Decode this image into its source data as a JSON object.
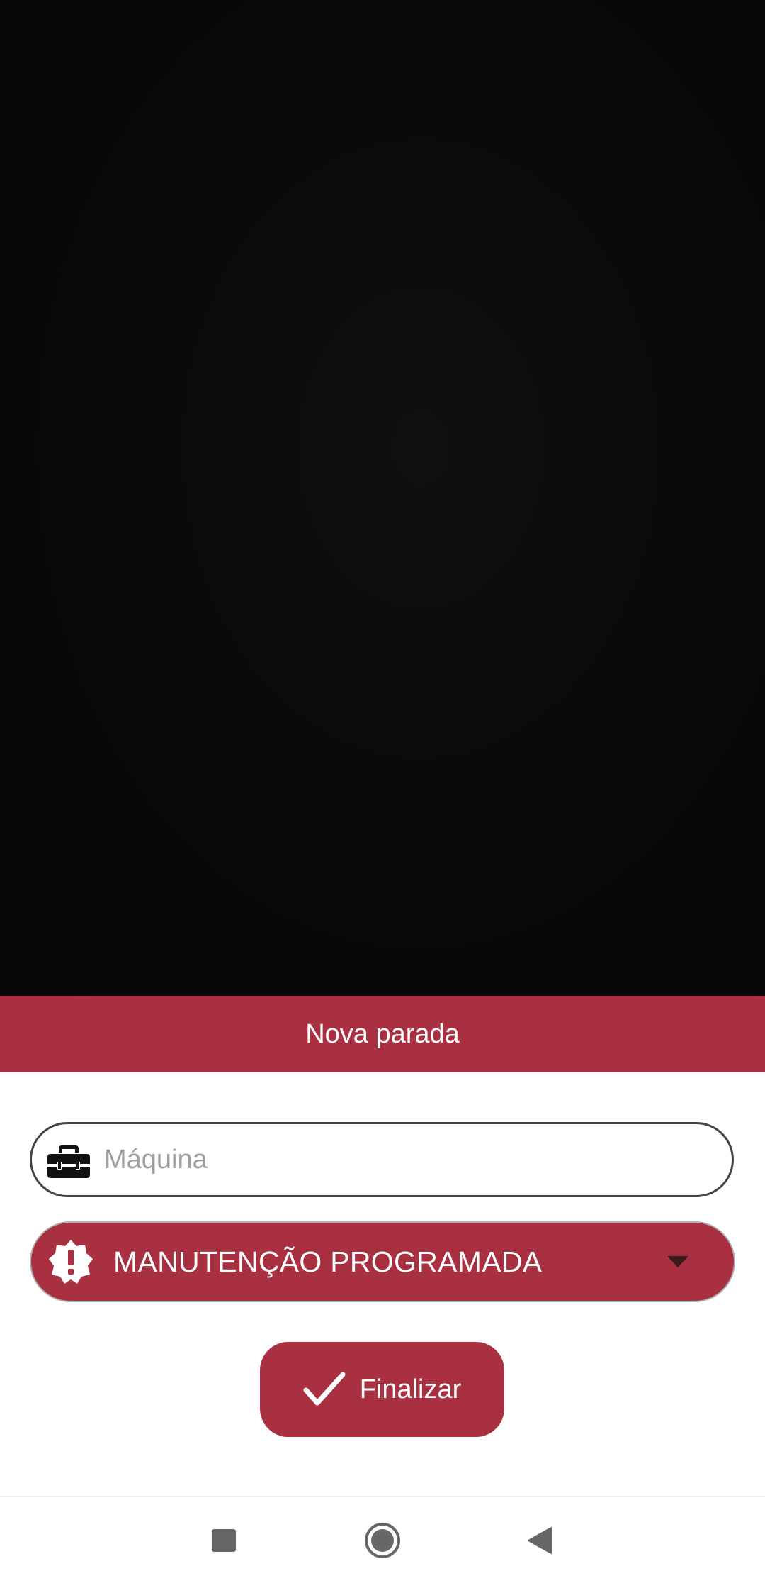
{
  "dialog": {
    "title": "Nova parada"
  },
  "machine_field": {
    "placeholder": "Máquina",
    "value": "",
    "icon": "toolbox-icon"
  },
  "stop_type_select": {
    "selected": "MANUTENÇÃO PROGRAMADA",
    "icon": "alert-badge-icon",
    "dropdown_icon": "caret-down-icon"
  },
  "finish_button": {
    "label": "Finalizar",
    "icon": "check-icon"
  },
  "colors": {
    "accent": "#a83040",
    "background_top": "#0a0a0a",
    "sheet_background": "#ffffff"
  },
  "nav_bar": {
    "recent_icon": "square-icon",
    "home_icon": "circle-icon",
    "back_icon": "triangle-back-icon"
  }
}
